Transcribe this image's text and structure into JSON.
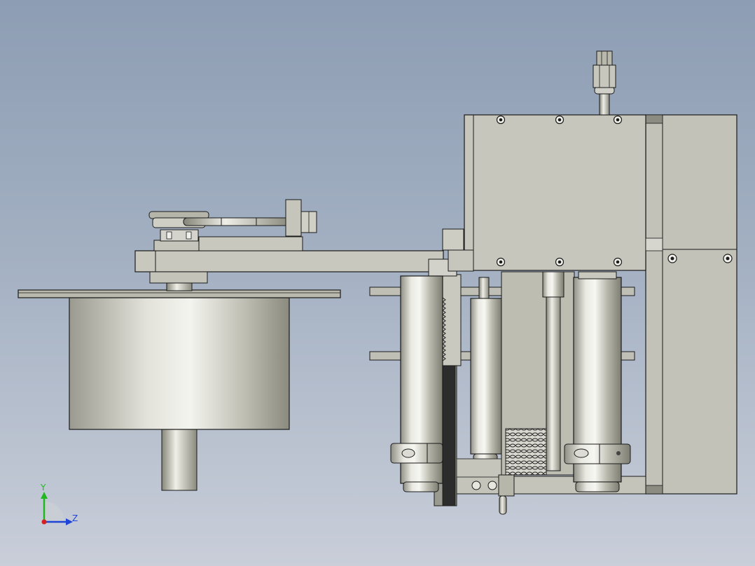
{
  "triad": {
    "y_label": "Y",
    "z_label": "Z"
  },
  "colors": {
    "bg_top": "#8d9db3",
    "bg_bottom": "#c9ced9",
    "part_fill": "#c5c5bb",
    "edge": "#1a1a1a",
    "axis_y": "#1fb81f",
    "axis_z": "#1f45d6",
    "axis_origin": "#d61f1f"
  },
  "model": {
    "name": "",
    "view": ""
  }
}
